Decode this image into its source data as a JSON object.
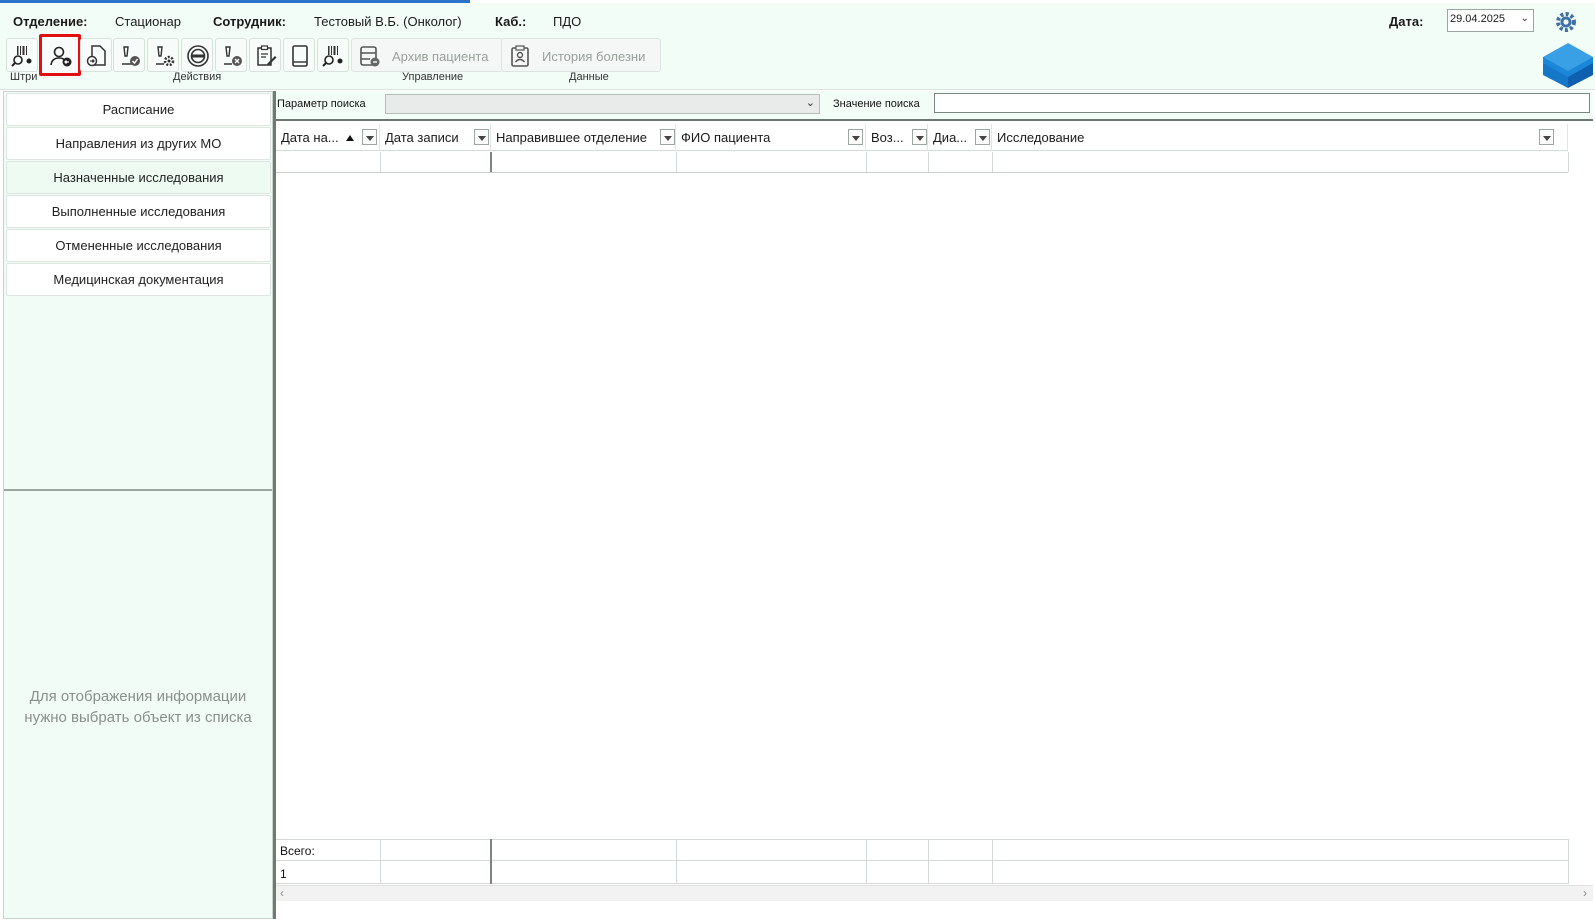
{
  "header": {
    "department_label": "Отделение:",
    "department_value": "Стационар",
    "employee_label": "Сотрудник:",
    "employee_value": "Тестовый В.Б. (Онколог)",
    "room_label": "Каб.:",
    "room_value": "ПДО",
    "date_label": "Дата:",
    "date_value": "29.04.2025"
  },
  "toolbar": {
    "archive_label": "Архив пациента",
    "history_label": "История болезни",
    "groups": [
      "Штри",
      "Действия",
      "Управление",
      "Данные"
    ]
  },
  "sidebar": {
    "items": [
      {
        "label": "Расписание"
      },
      {
        "label": "Направления из других МО"
      },
      {
        "label": "Назначенные исследования"
      },
      {
        "label": "Выполненные исследования"
      },
      {
        "label": "Отмененные исследования"
      },
      {
        "label": "Медицинская документация"
      }
    ],
    "empty_message_line1": "Для отображения информации",
    "empty_message_line2": "нужно выбрать объект из списка"
  },
  "search": {
    "param_label": "Параметр поиска",
    "param_value": "",
    "value_label": "Значение поиска",
    "value_value": ""
  },
  "grid": {
    "columns": [
      {
        "label": "Дата на..."
      },
      {
        "label": "Дата записи"
      },
      {
        "label": "Направившее отделение"
      },
      {
        "label": "ФИО пациента"
      },
      {
        "label": "Воз..."
      },
      {
        "label": "Диа..."
      },
      {
        "label": "Исследование"
      }
    ],
    "footer_total_label": "Всего:",
    "footer_total_value": "1"
  },
  "colors": {
    "accent": "#2b73c8",
    "panel_bg": "#f1fcf6",
    "highlight": "#e01010"
  }
}
